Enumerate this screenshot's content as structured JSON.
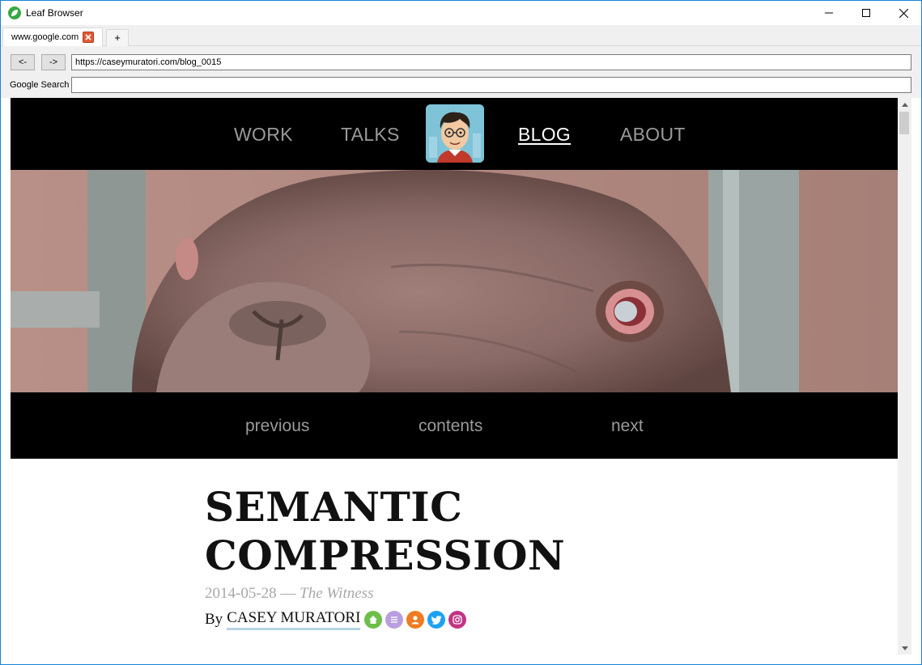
{
  "window": {
    "title": "Leaf Browser"
  },
  "tabs": [
    {
      "label": "www.google.com"
    }
  ],
  "tab_add_label": "+",
  "toolbar": {
    "back_label": "<-",
    "forward_label": "->",
    "url": "https://caseymuratori.com/blog_0015",
    "search_label": "Google Search",
    "search_value": ""
  },
  "site": {
    "nav": {
      "work": "WORK",
      "talks": "TALKS",
      "blog": "BLOG",
      "about": "ABOUT"
    },
    "post_nav": {
      "previous": "previous",
      "contents": "contents",
      "next": "next"
    },
    "article": {
      "title": "SEMANTIC COMPRESSION",
      "date": "2014-05-28",
      "separator": "—",
      "project": "The Witness",
      "by": "By",
      "author": "CASEY MURATORI"
    },
    "social_icons": [
      "home-icon",
      "blog-list-icon",
      "profile-icon",
      "twitter-icon",
      "instagram-icon"
    ]
  },
  "colors": {
    "window_border": "#1883d7",
    "nav_bg": "#000000",
    "nav_text": "#9a9a9a",
    "nav_active": "#ffffff",
    "author_underline": "#b8d4e6",
    "meta_text": "#a8a8a8"
  }
}
